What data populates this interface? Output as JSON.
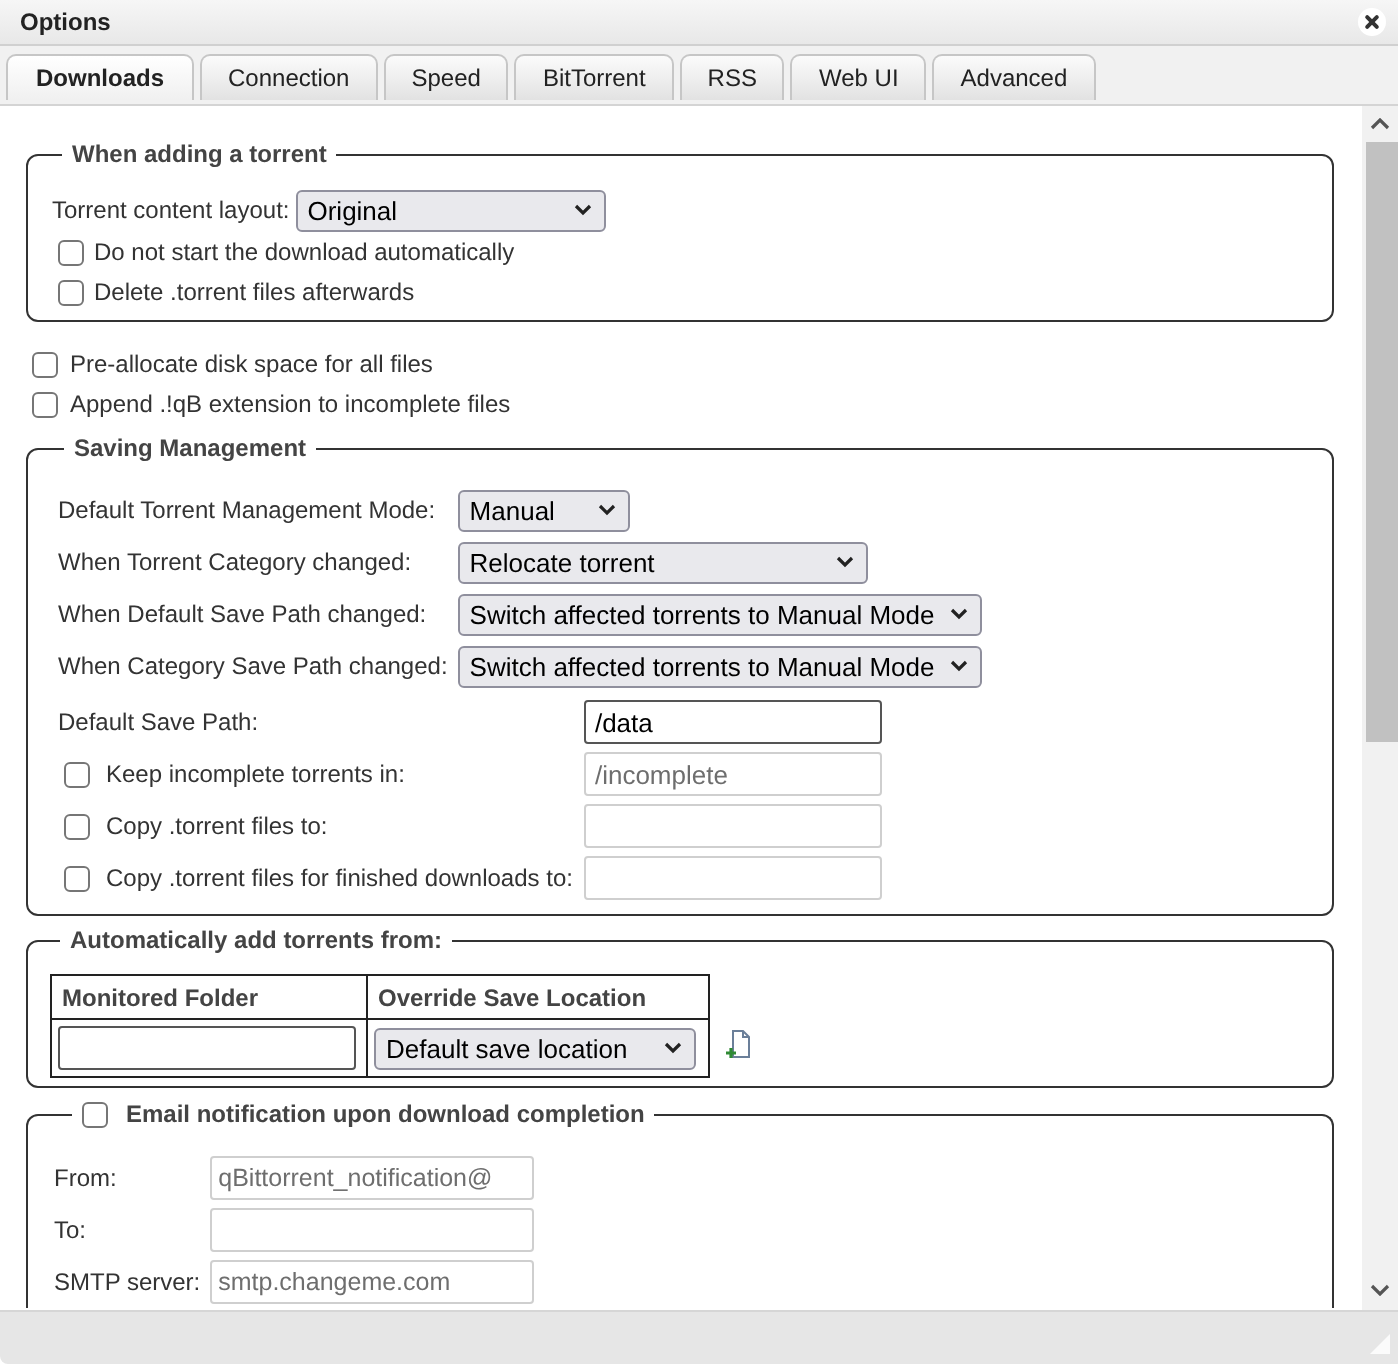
{
  "window": {
    "title": "Options"
  },
  "tabs": [
    {
      "label": "Downloads",
      "selected": true
    },
    {
      "label": "Connection",
      "selected": false
    },
    {
      "label": "Speed",
      "selected": false
    },
    {
      "label": "BitTorrent",
      "selected": false
    },
    {
      "label": "RSS",
      "selected": false
    },
    {
      "label": "Web UI",
      "selected": false
    },
    {
      "label": "Advanced",
      "selected": false
    }
  ],
  "adding_torrent": {
    "legend": "When adding a torrent",
    "content_layout": {
      "label": "Torrent content layout:",
      "value": "Original"
    },
    "options": [
      {
        "label": "Do not start the download automatically",
        "checked": false
      },
      {
        "label": "Delete .torrent files afterwards",
        "checked": false
      }
    ]
  },
  "file_options": [
    {
      "label": "Pre-allocate disk space for all files",
      "checked": false
    },
    {
      "label": "Append .!qB extension to incomplete files",
      "checked": false
    }
  ],
  "saving_management": {
    "legend": "Saving Management",
    "modes": [
      {
        "label": "Default Torrent Management Mode:",
        "value": "Manual"
      },
      {
        "label": "When Torrent Category changed:",
        "value": "Relocate torrent"
      },
      {
        "label": "When Default Save Path changed:",
        "value": "Switch affected torrents to Manual Mode"
      },
      {
        "label": "When Category Save Path changed:",
        "value": "Switch affected torrents to Manual Mode"
      }
    ],
    "paths": [
      {
        "kind": "input",
        "label": "Default Save Path:",
        "value": "/data",
        "disabled": false
      },
      {
        "kind": "checkbox-input",
        "label": "Keep incomplete torrents in:",
        "checked": false,
        "value": "/incomplete",
        "disabled": true
      },
      {
        "kind": "checkbox-input",
        "label": "Copy .torrent files to:",
        "checked": false,
        "disabled": true
      },
      {
        "kind": "checkbox-input",
        "label": "Copy .torrent files for finished downloads to:",
        "checked": false,
        "disabled": true
      }
    ]
  },
  "auto_add": {
    "legend": "Automatically add torrents from:",
    "columns": [
      "Monitored Folder",
      "Override Save Location"
    ],
    "rows": [
      {
        "save_location": "Default save location"
      }
    ]
  },
  "email": {
    "legend": "Email notification upon download completion",
    "checked": false,
    "fields": [
      {
        "label": "From:",
        "value": "qBittorrent_notification@",
        "disabled": true
      },
      {
        "label": "To:",
        "disabled": true
      },
      {
        "label": "SMTP server:",
        "value": "smtp.changeme.com",
        "disabled": true
      }
    ]
  }
}
